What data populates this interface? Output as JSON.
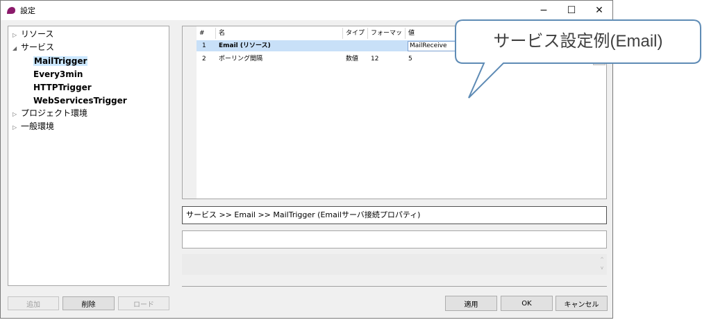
{
  "window": {
    "title": "設定",
    "controls": {
      "minimize": "−",
      "maximize": "☐",
      "close": "✕"
    }
  },
  "tree": {
    "items": [
      {
        "label": "リソース",
        "expanded": false
      },
      {
        "label": "サービス",
        "expanded": true,
        "children": [
          {
            "label": "MailTrigger",
            "selected": true
          },
          {
            "label": "Every3min"
          },
          {
            "label": "HTTPTrigger"
          },
          {
            "label": "WebServicesTrigger"
          }
        ]
      },
      {
        "label": "プロジェクト環境",
        "expanded": false
      },
      {
        "label": "一般環境",
        "expanded": false
      }
    ],
    "arrow_collapsed": "▷",
    "arrow_expanded": "◢"
  },
  "tree_buttons": {
    "add": "追加",
    "delete": "削除",
    "load": "ロード"
  },
  "table": {
    "headers": [
      "#",
      "名",
      "タイプ",
      "フォーマット",
      "値"
    ],
    "rows": [
      {
        "num": "1",
        "name": "Email (リソース)",
        "type": "",
        "format": "",
        "value": "MailReceive",
        "selected": true
      },
      {
        "num": "2",
        "name": "ポーリング間隔",
        "type": "数値",
        "format": "12",
        "value": "5",
        "selected": false
      }
    ]
  },
  "path_text": "サービス >> Email >> MailTrigger (Emailサーバ接続プロパティ)",
  "description_value": "",
  "detail_scroll": {
    "up": "^",
    "down": "v"
  },
  "footer_buttons": {
    "apply": "適用",
    "ok": "OK",
    "cancel": "キャンセル"
  },
  "callout": {
    "text": "サービス設定例(Email)"
  },
  "colors": {
    "accent_icon": "#8b1a6b",
    "selection": "#c8e0f8",
    "callout_border": "#5e8bb5"
  }
}
